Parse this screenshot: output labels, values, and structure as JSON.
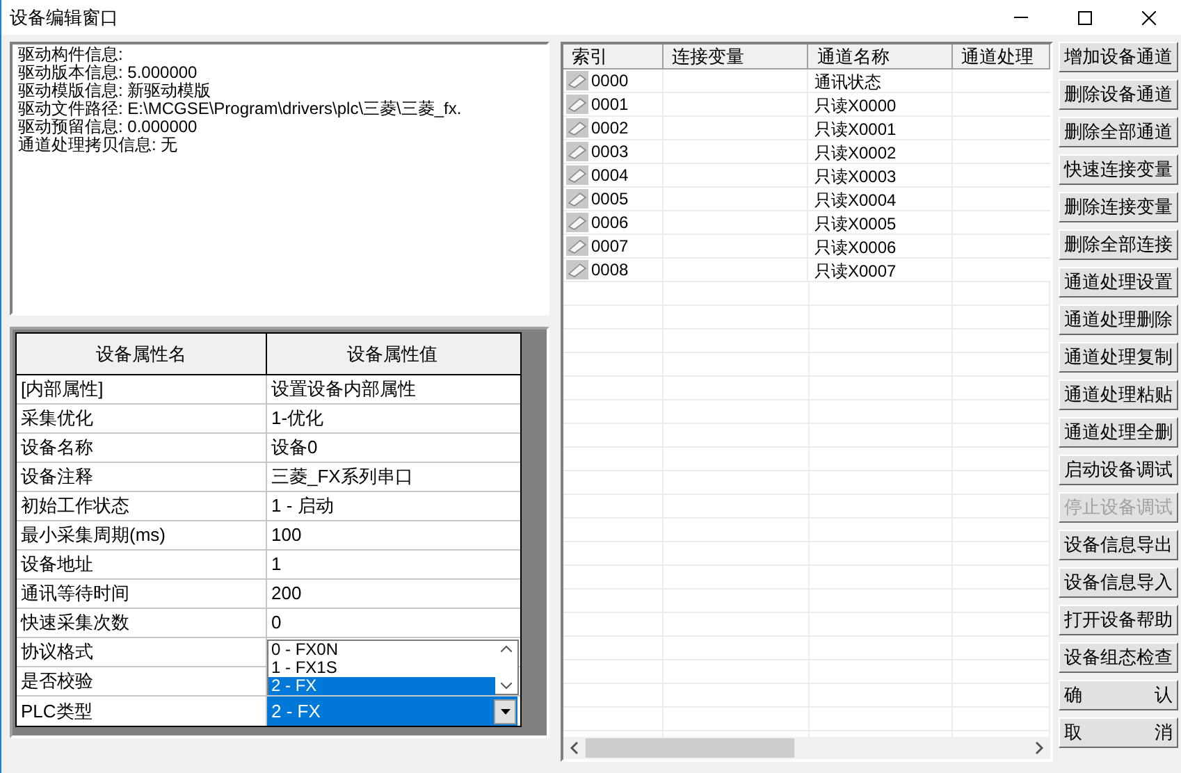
{
  "window": {
    "title": "设备编辑窗口"
  },
  "info_lines": [
    "驱动构件信息:",
    "驱动版本信息: 5.000000",
    "驱动模版信息: 新驱动模版",
    "驱动文件路径: E:\\MCGSE\\Program\\drivers\\plc\\三菱\\三菱_fx.",
    "驱动预留信息: 0.000000",
    "通道处理拷贝信息: 无"
  ],
  "property_table": {
    "columns": [
      "设备属性名",
      "设备属性值"
    ],
    "rows": [
      {
        "kind": "text",
        "name": "[内部属性]",
        "value": "设置设备内部属性"
      },
      {
        "kind": "text",
        "name": "采集优化",
        "value": "1-优化"
      },
      {
        "kind": "text",
        "name": "设备名称",
        "value": "设备0"
      },
      {
        "kind": "text",
        "name": "设备注释",
        "value": "三菱_FX系列串口"
      },
      {
        "kind": "text",
        "name": "初始工作状态",
        "value": "1 - 启动"
      },
      {
        "kind": "text",
        "name": "最小采集周期(ms)",
        "value": "100"
      },
      {
        "kind": "text",
        "name": "设备地址",
        "value": "1"
      },
      {
        "kind": "text",
        "name": "通讯等待时间",
        "value": "200"
      },
      {
        "kind": "text",
        "name": "快速采集次数",
        "value": "0"
      },
      {
        "kind": "covered",
        "name": "协议格式"
      },
      {
        "kind": "covered",
        "name": "是否校验"
      },
      {
        "kind": "combo",
        "name": "PLC类型",
        "value": "2 - FX"
      }
    ],
    "dropdown_options": [
      {
        "label": "0 - FX0N",
        "selected": false
      },
      {
        "label": "1 - FX1S",
        "selected": false
      },
      {
        "label": "2 - FX",
        "selected": true
      }
    ]
  },
  "channel_table": {
    "columns": [
      "索引",
      "连接变量",
      "通道名称",
      "通道处理"
    ],
    "rows": [
      {
        "index": "0000",
        "name": "通讯状态"
      },
      {
        "index": "0001",
        "name": "只读X0000"
      },
      {
        "index": "0002",
        "name": "只读X0001"
      },
      {
        "index": "0003",
        "name": "只读X0002"
      },
      {
        "index": "0004",
        "name": "只读X0003"
      },
      {
        "index": "0005",
        "name": "只读X0004"
      },
      {
        "index": "0006",
        "name": "只读X0005"
      },
      {
        "index": "0007",
        "name": "只读X0006"
      },
      {
        "index": "0008",
        "name": "只读X0007"
      }
    ]
  },
  "buttons": [
    {
      "label": "增加设备通道",
      "disabled": false
    },
    {
      "label": "删除设备通道",
      "disabled": false
    },
    {
      "label": "删除全部通道",
      "disabled": false
    },
    {
      "label": "快速连接变量",
      "disabled": false
    },
    {
      "label": "删除连接变量",
      "disabled": false
    },
    {
      "label": "删除全部连接",
      "disabled": false
    },
    {
      "label": "通道处理设置",
      "disabled": false
    },
    {
      "label": "通道处理删除",
      "disabled": false
    },
    {
      "label": "通道处理复制",
      "disabled": false
    },
    {
      "label": "通道处理粘贴",
      "disabled": false
    },
    {
      "label": "通道处理全删",
      "disabled": false
    },
    {
      "label": "启动设备调试",
      "disabled": false
    },
    {
      "label": "停止设备调试",
      "disabled": true
    },
    {
      "label": "设备信息导出",
      "disabled": false
    },
    {
      "label": "设备信息导入",
      "disabled": false
    },
    {
      "label": "打开设备帮助",
      "disabled": false
    },
    {
      "label": "设备组态检查",
      "disabled": false
    },
    {
      "label": "确　　　　认",
      "disabled": false
    },
    {
      "label": "取　　　　消",
      "disabled": false
    }
  ]
}
